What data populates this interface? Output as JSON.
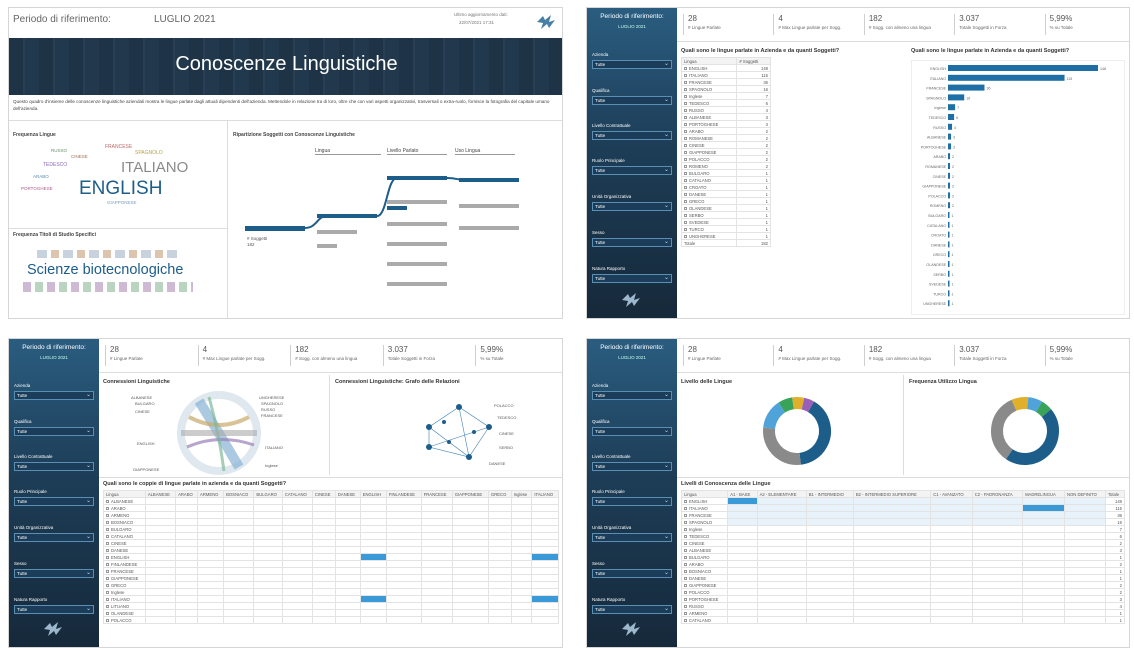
{
  "p1": {
    "period_label": "Periodo di riferimento:",
    "period_value": "LUGLIO 2021",
    "update_label": "Ultimo aggiornamento dati:",
    "update_value": "22/07/2021 17:31",
    "banner_title": "Conoscenze Linguistiche",
    "intro": "Questo quadro d'insieme delle conoscenze linguistiche aziendali mostra le lingue parlate dagli attuali dipendenti dell'azienda. Mettendole in relazione tra di loro, oltre che con vari aspetti organizzativi, trasversali o extra-ruolo, fornisce la fotografia del capitale umano dell'azienda.",
    "freq_lingue_title": "Frequenza Lingue",
    "freq_titoli_title": "Frequenza Titoli di Studio Specifici",
    "ripart_title": "Ripartizione Soggetti con Conoscenze Linguistiche",
    "wc_words": [
      "ENGLISH",
      "ITALIANO",
      "FRANCESE",
      "SPAGNOLO",
      "TEDESCO",
      "RUSSO",
      "CINESE",
      "ARABO",
      "PORTOGHESE",
      "GIAPPONESE"
    ],
    "wc2_main": "Scienze biotecnologiche",
    "tree_root": "# Soggetti",
    "tree_root_val": "182",
    "tree_heads": [
      "Lingua",
      "Livello Parlato",
      "Uso Lingua"
    ]
  },
  "common": {
    "period_label": "Periodo di riferimento:",
    "period_value": "LUGLIO 2021",
    "filters": [
      {
        "label": "Azienda",
        "value": "Tutte"
      },
      {
        "label": "Qualifica",
        "value": "Tutte"
      },
      {
        "label": "Livello Contrattuale",
        "value": "Tutte"
      },
      {
        "label": "Ruolo Principale",
        "value": "Tutte"
      },
      {
        "label": "Unità Organizzativa",
        "value": "Tutte"
      },
      {
        "label": "Sesso",
        "value": "Tutte"
      },
      {
        "label": "Natura Rapporto",
        "value": "Tutte"
      }
    ],
    "kpis": [
      {
        "value": "28",
        "label": "# Lingue Parlate"
      },
      {
        "value": "4",
        "label": "# Max Lingue parlate per Sogg."
      },
      {
        "value": "182",
        "label": "# Sogg. con almeno una lingua"
      },
      {
        "value": "3.037",
        "label": "Totale Soggetti in Forza"
      },
      {
        "value": "5,99%",
        "label": "% su Totale"
      }
    ]
  },
  "p2": {
    "table_title": "Quali sono le lingue parlate in Azienda e da quanti Soggetti?",
    "bar_title": "Quali sono le lingue parlate in Azienda e da quanti Soggetti?",
    "col_lingua": "Lingua",
    "col_sogg": "# Soggetti",
    "rows": [
      {
        "n": "ENGLISH",
        "v": "148"
      },
      {
        "n": "ITALIANO",
        "v": "115"
      },
      {
        "n": "FRANCESE",
        "v": "36"
      },
      {
        "n": "SPAGNOLO",
        "v": "16"
      },
      {
        "n": "Inglese",
        "v": "7"
      },
      {
        "n": "TEDESCO",
        "v": "6"
      },
      {
        "n": "RUSSO",
        "v": "4"
      },
      {
        "n": "ALBANESE",
        "v": "3"
      },
      {
        "n": "PORTOGHESE",
        "v": "3"
      },
      {
        "n": "ARABO",
        "v": "2"
      },
      {
        "n": "ROMANESE",
        "v": "2"
      },
      {
        "n": "CINESE",
        "v": "2"
      },
      {
        "n": "GIAPPONESE",
        "v": "2"
      },
      {
        "n": "POLACCO",
        "v": "2"
      },
      {
        "n": "ROMENO",
        "v": "2"
      },
      {
        "n": "BULGARO",
        "v": "1"
      },
      {
        "n": "CATALANO",
        "v": "1"
      },
      {
        "n": "CROATO",
        "v": "1"
      },
      {
        "n": "DANESE",
        "v": "1"
      },
      {
        "n": "GRECO",
        "v": "1"
      },
      {
        "n": "OLANDESE",
        "v": "1"
      },
      {
        "n": "SERBO",
        "v": "1"
      },
      {
        "n": "SVEDESE",
        "v": "1"
      },
      {
        "n": "TURCO",
        "v": "1"
      },
      {
        "n": "UNGHERESE",
        "v": "1"
      }
    ],
    "total_label": "Totale",
    "total_value": "182"
  },
  "p3": {
    "chord_title": "Connessioni Linguistiche",
    "graph_title": "Connessioni Linguistiche: Grafo delle Relazioni",
    "matrix_title": "Quali sono le coppie di lingue parlate in azienda e da quanti Soggetti?",
    "chord_labels": [
      "ALBANESE",
      "BULGARO",
      "CINESE",
      "ENGLISH",
      "GIAPPONESE",
      "UNGHERESE",
      "SPAGNOLO",
      "RUSSO",
      "FRANCESE",
      "ITALIANO",
      "Inglese"
    ],
    "graph_labels": [
      "POLACCO",
      "TEDESCO",
      "CINESE",
      "SERBO",
      "DANESE"
    ],
    "matrix_cols": [
      "Lingua",
      "ALBANESE",
      "ARABO",
      "ARMENO",
      "BOSNIACO",
      "BULGARO",
      "CATALANO",
      "CINESE",
      "DANESE",
      "ENGLISH",
      "FINLANDESE",
      "FRANCESE",
      "GIAPPONESE",
      "GRECO",
      "Inglese",
      "ITALIANO"
    ],
    "matrix_rows": [
      "ALBANESE",
      "ARABO",
      "ARMENO",
      "BOSNIACO",
      "BULGARO",
      "CATALANO",
      "CINESE",
      "DANESE",
      "ENGLISH",
      "FINLANDESE",
      "FRANCESE",
      "GIAPPONESE",
      "GRECO",
      "Inglese",
      "ITALIANO",
      "LITUANO",
      "OLANDESE",
      "POLACCO"
    ]
  },
  "p4": {
    "donut1_title": "Livello delle Lingue",
    "donut2_title": "Frequenza Utilizzo Lingua",
    "matrix_title": "Livelli di Conoscenza delle Lingue",
    "matrix_cols": [
      "Lingua",
      "A1 - BASE",
      "A2 - ELEMENTARE",
      "B1 - INTERMEDIO",
      "B2 - INTERMEDIO SUPERIORE",
      "C1 - AVANZATO",
      "C2 - PADRONANZA",
      "MADRELINGUA",
      "NON DEFINITO",
      "Totale"
    ],
    "rows": [
      {
        "n": "ENGLISH",
        "t": "148"
      },
      {
        "n": "ITALIANO",
        "t": "115"
      },
      {
        "n": "FRANCESE",
        "t": "36"
      },
      {
        "n": "SPAGNOLO",
        "t": "16"
      },
      {
        "n": "Inglese",
        "t": "7"
      },
      {
        "n": "TEDESCO",
        "t": "6"
      },
      {
        "n": "CINESE",
        "t": "2"
      },
      {
        "n": "ALBANESE",
        "t": "3"
      },
      {
        "n": "BULGARO",
        "t": "1"
      },
      {
        "n": "ARABO",
        "t": "2"
      },
      {
        "n": "BOSNIACO",
        "t": "1"
      },
      {
        "n": "DANESE",
        "t": "1"
      },
      {
        "n": "GIAPPONESE",
        "t": "2"
      },
      {
        "n": "POLACCO",
        "t": "2"
      },
      {
        "n": "PORTOGHESE",
        "t": "3"
      },
      {
        "n": "RUSSO",
        "t": "4"
      },
      {
        "n": "ARMENO",
        "t": "1"
      },
      {
        "n": "CATALANO",
        "t": "1"
      }
    ]
  }
}
